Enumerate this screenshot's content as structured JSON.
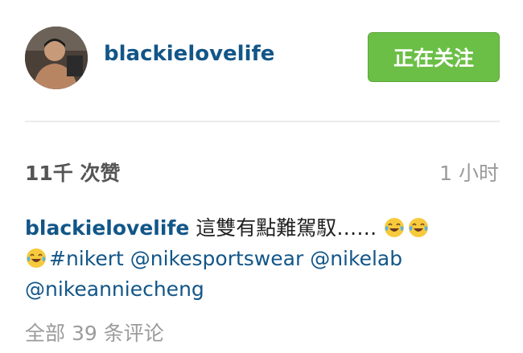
{
  "post": {
    "username": "blackielovelife",
    "follow_label": "正在关注",
    "likes": "11千 次赞",
    "time": "1 小时",
    "caption": {
      "username": "blackielovelife",
      "text": "這雙有點難駕馭……",
      "emoji_name": "face-with-tears-of-joy",
      "tags": [
        "#nikert",
        "@nikesportswear",
        "@nikelab",
        "@nikeanniecheng"
      ]
    },
    "comments_label": "全部 39 条评论"
  }
}
